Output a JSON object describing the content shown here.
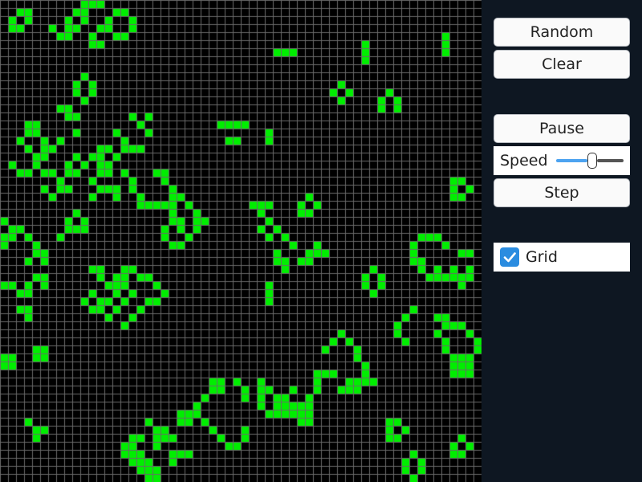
{
  "controls": {
    "random_label": "Random",
    "clear_label": "Clear",
    "pause_label": "Pause",
    "speed_label": "Speed",
    "speed_value": 0.54,
    "step_label": "Step",
    "grid_label": "Grid",
    "grid_checked": true
  },
  "board": {
    "columns": 60,
    "rows": 60,
    "background": "#000000",
    "cell_color": "#00ee00",
    "grid_line_color": "#6a6a6a",
    "live_cells": [
      [
        2,
        1
      ],
      [
        3,
        1
      ],
      [
        10,
        0
      ],
      [
        11,
        0
      ],
      [
        12,
        0
      ],
      [
        9,
        1
      ],
      [
        10,
        1
      ],
      [
        14,
        1
      ],
      [
        15,
        1
      ],
      [
        1,
        2
      ],
      [
        3,
        2
      ],
      [
        8,
        2
      ],
      [
        10,
        2
      ],
      [
        13,
        2
      ],
      [
        16,
        2
      ],
      [
        1,
        3
      ],
      [
        2,
        3
      ],
      [
        6,
        3
      ],
      [
        8,
        3
      ],
      [
        9,
        3
      ],
      [
        12,
        3
      ],
      [
        13,
        3
      ],
      [
        16,
        3
      ],
      [
        7,
        4
      ],
      [
        8,
        4
      ],
      [
        11,
        4
      ],
      [
        14,
        4
      ],
      [
        15,
        4
      ],
      [
        11,
        5
      ],
      [
        12,
        5
      ],
      [
        10,
        9
      ],
      [
        9,
        10
      ],
      [
        11,
        10
      ],
      [
        9,
        11
      ],
      [
        11,
        11
      ],
      [
        10,
        12
      ],
      [
        7,
        13
      ],
      [
        8,
        13
      ],
      [
        8,
        14
      ],
      [
        9,
        14
      ],
      [
        16,
        14
      ],
      [
        18,
        14
      ],
      [
        17,
        15
      ],
      [
        3,
        15
      ],
      [
        4,
        15
      ],
      [
        3,
        16
      ],
      [
        4,
        16
      ],
      [
        9,
        16
      ],
      [
        14,
        16
      ],
      [
        18,
        16
      ],
      [
        2,
        17
      ],
      [
        5,
        17
      ],
      [
        7,
        17
      ],
      [
        15,
        17
      ],
      [
        3,
        18
      ],
      [
        5,
        18
      ],
      [
        6,
        18
      ],
      [
        12,
        18
      ],
      [
        13,
        18
      ],
      [
        15,
        18
      ],
      [
        16,
        18
      ],
      [
        17,
        18
      ],
      [
        4,
        19
      ],
      [
        5,
        19
      ],
      [
        9,
        19
      ],
      [
        11,
        19
      ],
      [
        12,
        19
      ],
      [
        14,
        19
      ],
      [
        1,
        20
      ],
      [
        4,
        20
      ],
      [
        8,
        20
      ],
      [
        10,
        20
      ],
      [
        12,
        20
      ],
      [
        13,
        20
      ],
      [
        2,
        21
      ],
      [
        3,
        21
      ],
      [
        5,
        21
      ],
      [
        6,
        21
      ],
      [
        8,
        21
      ],
      [
        9,
        21
      ],
      [
        12,
        21
      ],
      [
        13,
        21
      ],
      [
        15,
        21
      ],
      [
        19,
        21
      ],
      [
        20,
        21
      ],
      [
        7,
        22
      ],
      [
        11,
        22
      ],
      [
        16,
        22
      ],
      [
        20,
        22
      ],
      [
        5,
        23
      ],
      [
        7,
        23
      ],
      [
        8,
        23
      ],
      [
        12,
        23
      ],
      [
        13,
        23
      ],
      [
        14,
        23
      ],
      [
        16,
        23
      ],
      [
        21,
        23
      ],
      [
        6,
        24
      ],
      [
        11,
        24
      ],
      [
        14,
        24
      ],
      [
        17,
        24
      ],
      [
        21,
        24
      ],
      [
        22,
        24
      ],
      [
        17,
        25
      ],
      [
        18,
        25
      ],
      [
        19,
        25
      ],
      [
        20,
        25
      ],
      [
        21,
        25
      ],
      [
        23,
        25
      ],
      [
        9,
        26
      ],
      [
        21,
        26
      ],
      [
        24,
        26
      ],
      [
        0,
        27
      ],
      [
        8,
        27
      ],
      [
        10,
        27
      ],
      [
        21,
        27
      ],
      [
        22,
        27
      ],
      [
        24,
        27
      ],
      [
        25,
        27
      ],
      [
        1,
        28
      ],
      [
        2,
        28
      ],
      [
        8,
        28
      ],
      [
        9,
        28
      ],
      [
        10,
        28
      ],
      [
        20,
        28
      ],
      [
        22,
        28
      ],
      [
        24,
        28
      ],
      [
        0,
        29
      ],
      [
        1,
        29
      ],
      [
        3,
        29
      ],
      [
        7,
        29
      ],
      [
        20,
        29
      ],
      [
        23,
        29
      ],
      [
        0,
        30
      ],
      [
        4,
        30
      ],
      [
        21,
        30
      ],
      [
        22,
        30
      ],
      [
        4,
        31
      ],
      [
        5,
        31
      ],
      [
        3,
        32
      ],
      [
        5,
        32
      ],
      [
        11,
        33
      ],
      [
        12,
        33
      ],
      [
        15,
        33
      ],
      [
        16,
        33
      ],
      [
        12,
        34
      ],
      [
        14,
        34
      ],
      [
        15,
        34
      ],
      [
        17,
        34
      ],
      [
        18,
        34
      ],
      [
        4,
        34
      ],
      [
        5,
        34
      ],
      [
        0,
        35
      ],
      [
        1,
        35
      ],
      [
        3,
        35
      ],
      [
        5,
        35
      ],
      [
        13,
        35
      ],
      [
        14,
        35
      ],
      [
        15,
        35
      ],
      [
        19,
        35
      ],
      [
        2,
        36
      ],
      [
        3,
        36
      ],
      [
        11,
        36
      ],
      [
        14,
        36
      ],
      [
        16,
        36
      ],
      [
        20,
        36
      ],
      [
        10,
        37
      ],
      [
        12,
        37
      ],
      [
        15,
        37
      ],
      [
        18,
        37
      ],
      [
        19,
        37
      ],
      [
        2,
        38
      ],
      [
        3,
        38
      ],
      [
        11,
        38
      ],
      [
        12,
        38
      ],
      [
        17,
        38
      ],
      [
        3,
        39
      ],
      [
        13,
        39
      ],
      [
        16,
        39
      ],
      [
        15,
        40
      ],
      [
        14,
        38
      ],
      [
        13,
        37
      ],
      [
        27,
        15
      ],
      [
        28,
        15
      ],
      [
        29,
        15
      ],
      [
        30,
        15
      ],
      [
        28,
        17
      ],
      [
        29,
        17
      ],
      [
        33,
        16
      ],
      [
        33,
        17
      ],
      [
        34,
        6
      ],
      [
        35,
        6
      ],
      [
        36,
        6
      ],
      [
        45,
        5
      ],
      [
        45,
        6
      ],
      [
        45,
        7
      ],
      [
        55,
        4
      ],
      [
        55,
        5
      ],
      [
        55,
        6
      ],
      [
        42,
        10
      ],
      [
        41,
        11
      ],
      [
        43,
        11
      ],
      [
        42,
        12
      ],
      [
        48,
        11
      ],
      [
        47,
        12
      ],
      [
        49,
        12
      ],
      [
        47,
        13
      ],
      [
        49,
        13
      ],
      [
        38,
        24
      ],
      [
        37,
        25
      ],
      [
        39,
        25
      ],
      [
        37,
        26
      ],
      [
        38,
        26
      ],
      [
        31,
        25
      ],
      [
        32,
        25
      ],
      [
        33,
        25
      ],
      [
        32,
        26
      ],
      [
        33,
        27
      ],
      [
        34,
        28
      ],
      [
        32,
        28
      ],
      [
        33,
        29
      ],
      [
        35,
        29
      ],
      [
        34,
        31
      ],
      [
        36,
        30
      ],
      [
        35,
        32
      ],
      [
        37,
        32
      ],
      [
        38,
        32
      ],
      [
        38,
        31
      ],
      [
        39,
        31
      ],
      [
        40,
        31
      ],
      [
        39,
        30
      ],
      [
        34,
        32
      ],
      [
        35,
        33
      ],
      [
        33,
        35
      ],
      [
        33,
        36
      ],
      [
        33,
        37
      ],
      [
        46,
        33
      ],
      [
        45,
        34
      ],
      [
        47,
        34
      ],
      [
        45,
        35
      ],
      [
        46,
        36
      ],
      [
        47,
        35
      ],
      [
        56,
        22
      ],
      [
        57,
        22
      ],
      [
        56,
        23
      ],
      [
        58,
        23
      ],
      [
        57,
        24
      ],
      [
        56,
        24
      ],
      [
        52,
        29
      ],
      [
        53,
        29
      ],
      [
        54,
        29
      ],
      [
        51,
        30
      ],
      [
        55,
        30
      ],
      [
        51,
        31
      ],
      [
        57,
        31
      ],
      [
        51,
        32
      ],
      [
        52,
        32
      ],
      [
        58,
        31
      ],
      [
        52,
        33
      ],
      [
        54,
        33
      ],
      [
        56,
        33
      ],
      [
        58,
        33
      ],
      [
        53,
        34
      ],
      [
        54,
        34
      ],
      [
        55,
        34
      ],
      [
        56,
        34
      ],
      [
        57,
        34
      ],
      [
        58,
        34
      ],
      [
        57,
        35
      ],
      [
        51,
        38
      ],
      [
        50,
        39
      ],
      [
        49,
        40
      ],
      [
        49,
        41
      ],
      [
        50,
        42
      ],
      [
        54,
        39
      ],
      [
        55,
        39
      ],
      [
        55,
        40
      ],
      [
        56,
        40
      ],
      [
        57,
        40
      ],
      [
        54,
        41
      ],
      [
        58,
        41
      ],
      [
        55,
        42
      ],
      [
        59,
        42
      ],
      [
        55,
        43
      ],
      [
        59,
        43
      ],
      [
        56,
        44
      ],
      [
        57,
        44
      ],
      [
        58,
        44
      ],
      [
        56,
        45
      ],
      [
        57,
        45
      ],
      [
        58,
        45
      ],
      [
        56,
        46
      ],
      [
        57,
        46
      ],
      [
        58,
        46
      ],
      [
        41,
        42
      ],
      [
        42,
        41
      ],
      [
        43,
        42
      ],
      [
        40,
        43
      ],
      [
        44,
        43
      ],
      [
        44,
        44
      ],
      [
        45,
        45
      ],
      [
        45,
        46
      ],
      [
        45,
        47
      ],
      [
        44,
        47
      ],
      [
        39,
        46
      ],
      [
        40,
        46
      ],
      [
        41,
        46
      ],
      [
        43,
        47
      ],
      [
        46,
        47
      ],
      [
        42,
        48
      ],
      [
        43,
        48
      ],
      [
        44,
        48
      ],
      [
        39,
        47
      ],
      [
        39,
        48
      ],
      [
        38,
        49
      ],
      [
        38,
        50
      ],
      [
        37,
        50
      ],
      [
        37,
        51
      ],
      [
        36,
        48
      ],
      [
        35,
        49
      ],
      [
        34,
        49
      ],
      [
        34,
        50
      ],
      [
        35,
        50
      ],
      [
        36,
        50
      ],
      [
        33,
        48
      ],
      [
        32,
        47
      ],
      [
        32,
        48
      ],
      [
        32,
        49
      ],
      [
        32,
        50
      ],
      [
        33,
        51
      ],
      [
        34,
        51
      ],
      [
        35,
        51
      ],
      [
        36,
        51
      ],
      [
        38,
        51
      ],
      [
        38,
        52
      ],
      [
        37,
        52
      ],
      [
        29,
        47
      ],
      [
        30,
        48
      ],
      [
        30,
        49
      ],
      [
        26,
        47
      ],
      [
        27,
        47
      ],
      [
        26,
        48
      ],
      [
        27,
        48
      ],
      [
        25,
        49
      ],
      [
        24,
        50
      ],
      [
        24,
        51
      ],
      [
        22,
        51
      ],
      [
        23,
        51
      ],
      [
        22,
        52
      ],
      [
        23,
        52
      ],
      [
        25,
        52
      ],
      [
        26,
        53
      ],
      [
        27,
        54
      ],
      [
        28,
        55
      ],
      [
        29,
        55
      ],
      [
        30,
        54
      ],
      [
        30,
        53
      ],
      [
        18,
        52
      ],
      [
        19,
        53
      ],
      [
        20,
        53
      ],
      [
        19,
        54
      ],
      [
        20,
        54
      ],
      [
        21,
        54
      ],
      [
        16,
        54
      ],
      [
        17,
        54
      ],
      [
        15,
        55
      ],
      [
        16,
        55
      ],
      [
        19,
        55
      ],
      [
        15,
        56
      ],
      [
        16,
        56
      ],
      [
        17,
        56
      ],
      [
        16,
        57
      ],
      [
        17,
        57
      ],
      [
        18,
        57
      ],
      [
        17,
        58
      ],
      [
        18,
        58
      ],
      [
        19,
        58
      ],
      [
        18,
        59
      ],
      [
        19,
        59
      ],
      [
        21,
        56
      ],
      [
        22,
        56
      ],
      [
        23,
        56
      ],
      [
        21,
        57
      ],
      [
        3,
        52
      ],
      [
        4,
        53
      ],
      [
        4,
        54
      ],
      [
        5,
        53
      ],
      [
        0,
        44
      ],
      [
        1,
        44
      ],
      [
        0,
        45
      ],
      [
        1,
        45
      ],
      [
        4,
        43
      ],
      [
        5,
        43
      ],
      [
        4,
        44
      ],
      [
        5,
        44
      ],
      [
        48,
        52
      ],
      [
        49,
        52
      ],
      [
        48,
        53
      ],
      [
        50,
        53
      ],
      [
        48,
        54
      ],
      [
        49,
        54
      ],
      [
        57,
        54
      ],
      [
        56,
        55
      ],
      [
        58,
        55
      ],
      [
        56,
        56
      ],
      [
        57,
        56
      ],
      [
        51,
        56
      ],
      [
        50,
        57
      ],
      [
        52,
        57
      ],
      [
        50,
        58
      ],
      [
        52,
        58
      ],
      [
        51,
        59
      ]
    ]
  }
}
